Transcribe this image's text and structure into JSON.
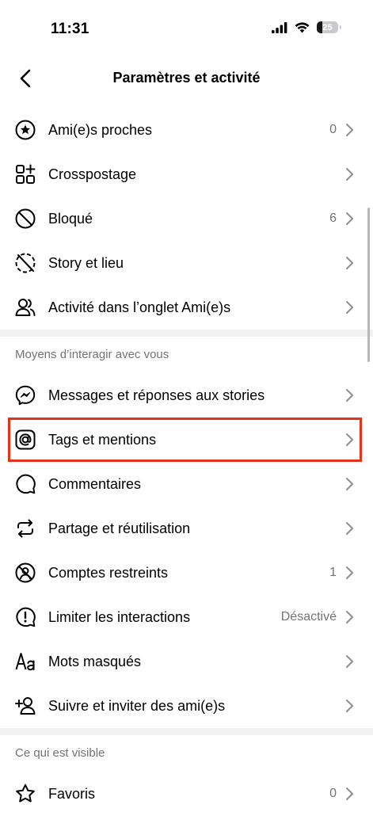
{
  "status_bar": {
    "time": "11:31",
    "battery": "25",
    "battery_percent": 25
  },
  "header": {
    "title": "Paramètres et activité",
    "back_icon": "chevron-left-icon"
  },
  "sections": [
    {
      "items": [
        {
          "icon": "star-circle-icon",
          "label": "Ami(e)s proches",
          "value": "0"
        },
        {
          "icon": "crosspost-icon",
          "label": "Crosspostage",
          "value": ""
        },
        {
          "icon": "blocked-icon",
          "label": "Bloqué",
          "value": "6"
        },
        {
          "icon": "story-location-icon",
          "label": "Story et lieu",
          "value": ""
        },
        {
          "icon": "friends-activity-icon",
          "label": "Activité dans l’onglet Ami(e)s",
          "value": ""
        }
      ]
    },
    {
      "title": "Moyens d’interagir avec vous",
      "items": [
        {
          "icon": "messenger-icon",
          "label": "Messages et réponses aux stories",
          "value": ""
        },
        {
          "icon": "at-icon",
          "label": "Tags et mentions",
          "value": ""
        },
        {
          "icon": "comment-icon",
          "label": "Commentaires",
          "value": ""
        },
        {
          "icon": "share-remix-icon",
          "label": "Partage et réutilisation",
          "value": ""
        },
        {
          "icon": "restricted-icon",
          "label": "Comptes restreints",
          "value": "1"
        },
        {
          "icon": "limit-alert-icon",
          "label": "Limiter les interactions",
          "value": "Désactivé"
        },
        {
          "icon": "hidden-words-icon",
          "label": "Mots masqués",
          "value": ""
        },
        {
          "icon": "add-friend-icon",
          "label": "Suivre et inviter des ami(e)s",
          "value": ""
        }
      ]
    },
    {
      "title": "Ce qui est visible",
      "items": [
        {
          "icon": "star-icon",
          "label": "Favoris",
          "value": "0"
        }
      ]
    }
  ],
  "highlight_color": "#e2341d"
}
